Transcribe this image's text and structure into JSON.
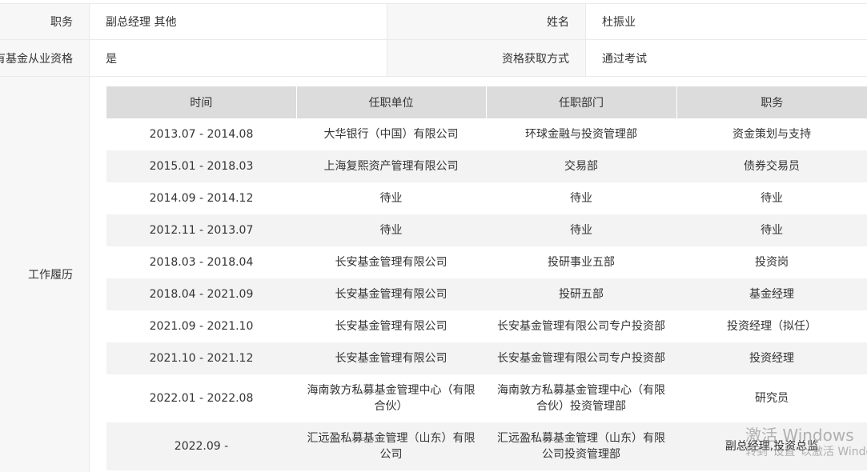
{
  "info": {
    "row1": {
      "label1": "职务",
      "value1": "副总经理 其他",
      "label2": "姓名",
      "value2": "杜振业"
    },
    "row2": {
      "label1": "有基金从业资格",
      "value1": "是",
      "label2": "资格获取方式",
      "value2": "通过考试"
    }
  },
  "work_history": {
    "label": "工作履历",
    "headers": [
      "时间",
      "任职单位",
      "任职部门",
      "职务"
    ],
    "rows": [
      {
        "time": "2013.07 - 2014.08",
        "unit": "大华银行（中国）有限公司",
        "dept": "环球金融与投资管理部",
        "position": "资金策划与支持"
      },
      {
        "time": "2015.01 - 2018.03",
        "unit": "上海复熙资产管理有限公司",
        "dept": "交易部",
        "position": "债券交易员"
      },
      {
        "time": "2014.09 - 2014.12",
        "unit": "待业",
        "dept": "待业",
        "position": "待业"
      },
      {
        "time": "2012.11 - 2013.07",
        "unit": "待业",
        "dept": "待业",
        "position": "待业"
      },
      {
        "time": "2018.03 - 2018.04",
        "unit": "长安基金管理有限公司",
        "dept": "投研事业五部",
        "position": "投资岗"
      },
      {
        "time": "2018.04 - 2021.09",
        "unit": "长安基金管理有限公司",
        "dept": "投研五部",
        "position": "基金经理"
      },
      {
        "time": "2021.09 - 2021.10",
        "unit": "长安基金管理有限公司",
        "dept": "长安基金管理有限公司专户投资部",
        "position": "投资经理（拟任）"
      },
      {
        "time": "2021.10 - 2021.12",
        "unit": "长安基金管理有限公司",
        "dept": "长安基金管理有限公司专户投资部",
        "position": "投资经理"
      },
      {
        "time": "2022.01 - 2022.08",
        "unit": "海南敦方私募基金管理中心（有限合伙）",
        "dept": "海南敦方私募基金管理中心（有限合伙）投资管理部",
        "position": "研究员"
      },
      {
        "time": "2022.09 -",
        "unit": "汇远盈私募基金管理（山东）有限公司",
        "dept": "汇远盈私募基金管理（山东）有限公司投资管理部",
        "position": "副总经理,投资总监"
      }
    ]
  },
  "watermark": {
    "line1": "激活 Windows",
    "line2": "转到\"设置\"以激活 Windows。"
  }
}
